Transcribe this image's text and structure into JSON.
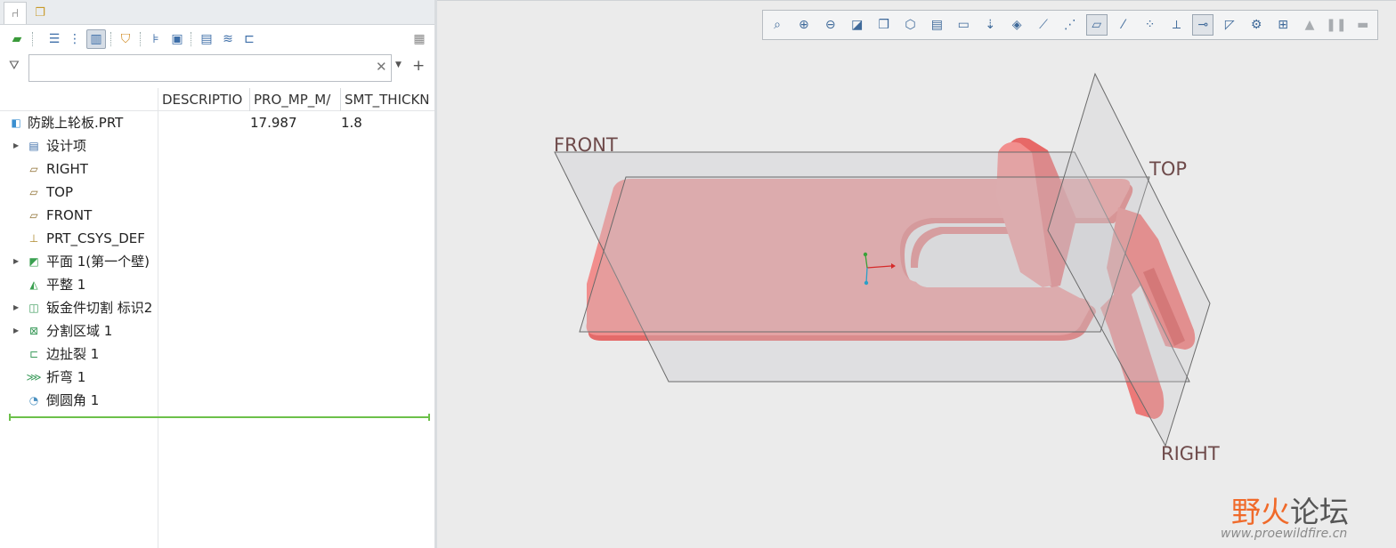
{
  "left_panel": {
    "tabs": [
      {
        "icon": "model-tree-icon",
        "glyph": "⑁"
      },
      {
        "icon": "layers-icon",
        "glyph": "❐"
      }
    ],
    "toolbar_icons": [
      "show-icon",
      "tree-columns-icon",
      "tree-filters-icon",
      "settings-icon",
      "layer-icon",
      "feature-filter-icon",
      "copy-icon",
      "list-icon",
      "stack-icon",
      "hierarchy-icon",
      "notes-icon"
    ],
    "search": {
      "value": "",
      "placeholder": ""
    },
    "columns": [
      "DESCRIPTIO",
      "PRO_MP_M/",
      "SMT_THICKN"
    ],
    "tree": [
      {
        "label": "防跳上轮板.PRT",
        "icon": "part-icon",
        "expandable": false,
        "indent": 0,
        "desc": "",
        "mass": "17.987",
        "thick": "1.8"
      },
      {
        "label": "设计项",
        "icon": "design-items-icon",
        "expandable": true,
        "indent": 1,
        "desc": "",
        "mass": "",
        "thick": ""
      },
      {
        "label": "RIGHT",
        "icon": "datum-plane-icon",
        "expandable": false,
        "indent": 1,
        "desc": "",
        "mass": "",
        "thick": ""
      },
      {
        "label": "TOP",
        "icon": "datum-plane-icon",
        "expandable": false,
        "indent": 1,
        "desc": "",
        "mass": "",
        "thick": ""
      },
      {
        "label": "FRONT",
        "icon": "datum-plane-icon",
        "expandable": false,
        "indent": 1,
        "desc": "",
        "mass": "",
        "thick": ""
      },
      {
        "label": "PRT_CSYS_DEF",
        "icon": "coordinate-system-icon",
        "expandable": false,
        "indent": 1,
        "desc": "",
        "mass": "",
        "thick": ""
      },
      {
        "label": "平面 1(第一个壁)",
        "icon": "planar-wall-icon",
        "expandable": true,
        "indent": 1,
        "desc": "",
        "mass": "",
        "thick": ""
      },
      {
        "label": "平整 1",
        "icon": "flat-wall-icon",
        "expandable": false,
        "indent": 1,
        "desc": "",
        "mass": "",
        "thick": ""
      },
      {
        "label": "钣金件切割 标识2",
        "icon": "sheetmetal-cut-icon",
        "expandable": true,
        "indent": 1,
        "desc": "",
        "mass": "",
        "thick": ""
      },
      {
        "label": "分割区域 1",
        "icon": "split-area-icon",
        "expandable": true,
        "indent": 1,
        "desc": "",
        "mass": "",
        "thick": ""
      },
      {
        "label": "边扯裂 1",
        "icon": "edge-rip-icon",
        "expandable": false,
        "indent": 1,
        "desc": "",
        "mass": "",
        "thick": ""
      },
      {
        "label": "折弯 1",
        "icon": "bend-icon",
        "expandable": false,
        "indent": 1,
        "desc": "",
        "mass": "",
        "thick": ""
      },
      {
        "label": "倒圆角 1",
        "icon": "round-icon",
        "expandable": false,
        "indent": 1,
        "desc": "",
        "mass": "",
        "thick": ""
      }
    ]
  },
  "graphics": {
    "toolbar": [
      {
        "name": "refit-icon",
        "glyph": "⌕",
        "state": ""
      },
      {
        "name": "zoom-in-icon",
        "glyph": "⊕",
        "state": ""
      },
      {
        "name": "zoom-out-icon",
        "glyph": "⊖",
        "state": ""
      },
      {
        "name": "repaint-icon",
        "glyph": "◪",
        "state": ""
      },
      {
        "name": "display-style-icon",
        "glyph": "❒",
        "state": ""
      },
      {
        "name": "saved-orientations-icon",
        "glyph": "⬡",
        "state": ""
      },
      {
        "name": "view-manager-icon",
        "glyph": "▤",
        "state": ""
      },
      {
        "name": "perspective-icon",
        "glyph": "▭",
        "state": ""
      },
      {
        "name": "section-icon",
        "glyph": "⇣",
        "state": ""
      },
      {
        "name": "appearance-icon",
        "glyph": "◈",
        "state": ""
      },
      {
        "name": "datum-axis-display-icon",
        "glyph": "⟋",
        "state": ""
      },
      {
        "name": "annotation-display-icon",
        "glyph": "⋰",
        "state": ""
      },
      {
        "name": "plane-display-icon",
        "glyph": "▱",
        "state": "sel"
      },
      {
        "name": "axis-display-icon",
        "glyph": "⁄",
        "state": ""
      },
      {
        "name": "point-display-icon",
        "glyph": "⁘",
        "state": ""
      },
      {
        "name": "csys-display-icon",
        "glyph": "⟂",
        "state": ""
      },
      {
        "name": "spin-center-icon",
        "glyph": "⊸",
        "state": "sel"
      },
      {
        "name": "tag-display-icon",
        "glyph": "◸",
        "state": ""
      },
      {
        "name": "environment-icon",
        "glyph": "⚙",
        "state": ""
      },
      {
        "name": "section-view-icon",
        "glyph": "⊞",
        "state": ""
      },
      {
        "name": "render-icon",
        "glyph": "▲",
        "state": "dim"
      },
      {
        "name": "pause-icon",
        "glyph": "❚❚",
        "state": "dim"
      },
      {
        "name": "clear-icon",
        "glyph": "▬",
        "state": "dim"
      }
    ],
    "plane_labels": {
      "front": "FRONT",
      "top": "TOP",
      "right": "RIGHT"
    },
    "colors": {
      "part": "#f08a89",
      "part_dark": "#e0605f",
      "plane_fill": "rgba(200,200,205,0.35)",
      "plane_stroke": "#6b6b6b"
    }
  },
  "watermark": {
    "text_part1": "野火",
    "text_part2": "论坛",
    "url": "www.proewildfire.cn",
    "color1": "#f06a2a",
    "color2": "#555555"
  }
}
